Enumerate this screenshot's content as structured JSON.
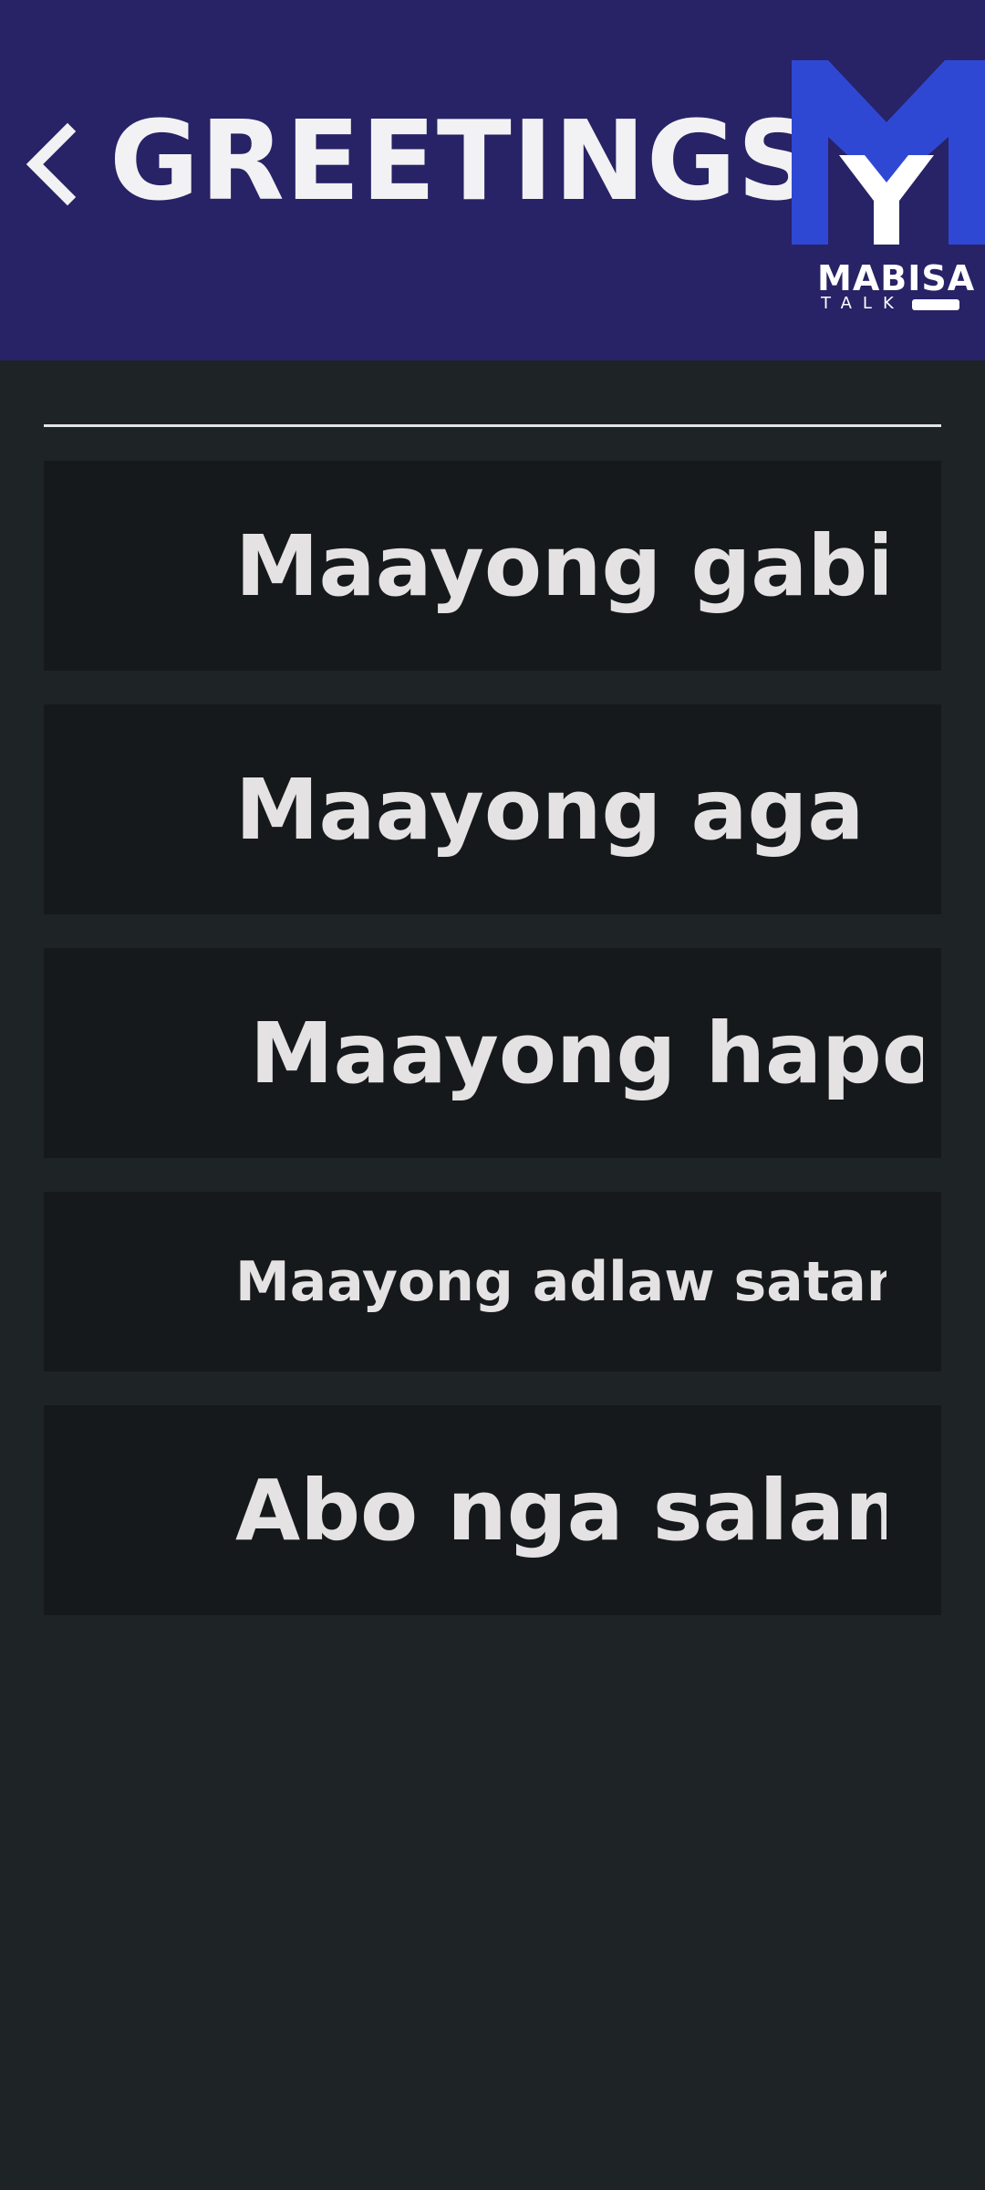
{
  "header": {
    "title": "GREETINGS",
    "back_icon": "chevron-left-icon",
    "background_color": "#282266",
    "logo": {
      "wordmark": "MABISA",
      "subtext": "TALK",
      "accent_color": "#2f48d4"
    }
  },
  "phrases": [
    {
      "label": "Maayong gabi"
    },
    {
      "label": "Maayong aga"
    },
    {
      "label": "Maayong hapon"
    },
    {
      "label": "Maayong adlaw satanan"
    },
    {
      "label": "Abo nga salamt"
    }
  ],
  "colors": {
    "background": "#1e2326",
    "card": "#16191b",
    "text": "#e4e2e3"
  }
}
